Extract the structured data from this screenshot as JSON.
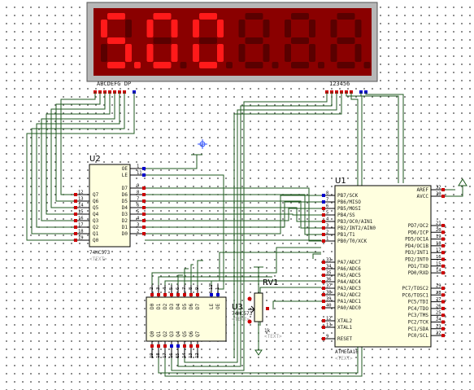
{
  "display": {
    "digits": [
      "5.",
      "0",
      "0",
      "8",
      "8",
      "8"
    ],
    "lit": [
      true,
      true,
      true,
      false,
      false,
      false
    ],
    "segment_pins_label": "ABCDEFG DP",
    "digit_pins_label": "123456",
    "on_color": "#ff1a1a",
    "off_color": "#5a0000",
    "background": "#8a0000"
  },
  "u2": {
    "ref": "U2",
    "part": "74HC573",
    "text": "<TEXT>",
    "pins_left": [
      {
        "num": "12",
        "name": "Q7"
      },
      {
        "num": "13",
        "name": "Q6"
      },
      {
        "num": "14",
        "name": "Q5"
      },
      {
        "num": "15",
        "name": "Q4"
      },
      {
        "num": "16",
        "name": "Q3"
      },
      {
        "num": "17",
        "name": "Q2"
      },
      {
        "num": "18",
        "name": "Q1"
      },
      {
        "num": "19",
        "name": "Q0"
      }
    ],
    "pins_right": [
      {
        "num": "1",
        "name": "OE"
      },
      {
        "num": "11",
        "name": "LE"
      },
      {
        "num": "9",
        "name": "D7"
      },
      {
        "num": "8",
        "name": "D6"
      },
      {
        "num": "7",
        "name": "D5"
      },
      {
        "num": "6",
        "name": "D4"
      },
      {
        "num": "5",
        "name": "D3"
      },
      {
        "num": "4",
        "name": "D2"
      },
      {
        "num": "3",
        "name": "D1"
      },
      {
        "num": "2",
        "name": "D0"
      }
    ]
  },
  "u3": {
    "ref": "U3",
    "part": "74HC573",
    "text": "<TEXT>",
    "pins_top": [
      {
        "num": "2",
        "name": "D0"
      },
      {
        "num": "3",
        "name": "D1"
      },
      {
        "num": "4",
        "name": "D2"
      },
      {
        "num": "5",
        "name": "D3"
      },
      {
        "num": "6",
        "name": "D4"
      },
      {
        "num": "7",
        "name": "D5"
      },
      {
        "num": "8",
        "name": "D6"
      },
      {
        "num": "9",
        "name": "D7"
      },
      {
        "num": "11",
        "name": "LE"
      },
      {
        "num": "1",
        "name": "OE"
      }
    ],
    "pins_bottom": [
      {
        "num": "19",
        "name": "Q0"
      },
      {
        "num": "18",
        "name": "Q1"
      },
      {
        "num": "17",
        "name": "Q2"
      },
      {
        "num": "16",
        "name": "Q3"
      },
      {
        "num": "15",
        "name": "Q4"
      },
      {
        "num": "14",
        "name": "Q5"
      },
      {
        "num": "13",
        "name": "Q6"
      },
      {
        "num": "12",
        "name": "Q7"
      }
    ]
  },
  "u1": {
    "ref": "U1",
    "part": "ATMEGA16",
    "text": "<TEXT>",
    "pins_left": [
      {
        "num": "1",
        "name": "PB0/T0/XCK"
      },
      {
        "num": "2",
        "name": "PB1/T1"
      },
      {
        "num": "3",
        "name": "PB2/INT2/AIN0"
      },
      {
        "num": "4",
        "name": "PB3/OC0/AIN1"
      },
      {
        "num": "5",
        "name": "PB4/SS"
      },
      {
        "num": "6",
        "name": "PB5/MOSI"
      },
      {
        "num": "7",
        "name": "PB6/MISO"
      },
      {
        "num": "8",
        "name": "PB7/SCK"
      },
      {
        "num": "40",
        "name": "PA0/ADC0"
      },
      {
        "num": "39",
        "name": "PA1/ADC1"
      },
      {
        "num": "38",
        "name": "PA2/ADC2"
      },
      {
        "num": "37",
        "name": "PA3/ADC3"
      },
      {
        "num": "36",
        "name": "PA4/ADC4"
      },
      {
        "num": "35",
        "name": "PA5/ADC5"
      },
      {
        "num": "34",
        "name": "PA6/ADC6"
      },
      {
        "num": "33",
        "name": "PA7/ADC7"
      },
      {
        "num": "13",
        "name": "XTAL1"
      },
      {
        "num": "12",
        "name": "XTAL2"
      },
      {
        "num": "9",
        "name": "RESET"
      }
    ],
    "pins_right": [
      {
        "num": "32",
        "name": "AREF"
      },
      {
        "num": "30",
        "name": "AVCC"
      },
      {
        "num": "21",
        "name": "PD7/OC2"
      },
      {
        "num": "20",
        "name": "PD6/ICP"
      },
      {
        "num": "19",
        "name": "PD5/OC1A"
      },
      {
        "num": "18",
        "name": "PD4/OC1B"
      },
      {
        "num": "17",
        "name": "PD3/INT1"
      },
      {
        "num": "16",
        "name": "PD2/INT0"
      },
      {
        "num": "15",
        "name": "PD1/TXD"
      },
      {
        "num": "14",
        "name": "PD0/RXD"
      },
      {
        "num": "29",
        "name": "PC7/TOSC2"
      },
      {
        "num": "28",
        "name": "PC6/TOSC1"
      },
      {
        "num": "27",
        "name": "PC5/TDI"
      },
      {
        "num": "26",
        "name": "PC4/TDO"
      },
      {
        "num": "25",
        "name": "PC3/TMS"
      },
      {
        "num": "24",
        "name": "PC2/TCK"
      },
      {
        "num": "23",
        "name": "PC1/SDA"
      },
      {
        "num": "22",
        "name": "PC0/SCL"
      }
    ]
  },
  "rv1": {
    "ref": "RV1",
    "value": "1k",
    "text": "<TEXT>"
  },
  "colors": {
    "wire": "#1f5a1f",
    "body": "#ffffdf",
    "outline": "#000000",
    "pin_red": "#cc0000",
    "pin_blue": "#0000cc",
    "text": "#000000"
  }
}
